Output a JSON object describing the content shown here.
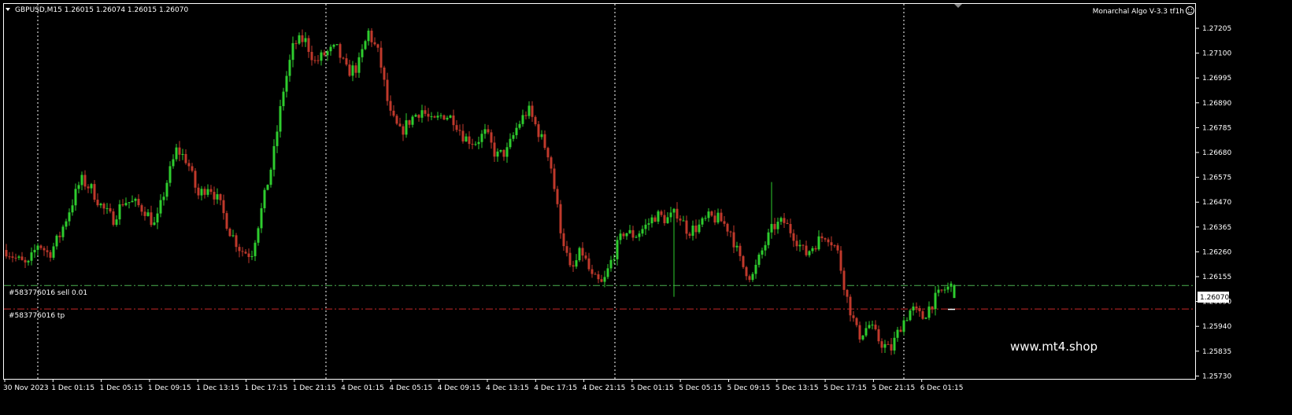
{
  "header": {
    "symbol_line": "GBPUSD,M15  1.26015 1.26074 1.26015 1.26070",
    "indicator": "Monarchal Algo V-3.3 tf1h",
    "smiley_icon": "smiley-icon"
  },
  "order_lines": {
    "sell": {
      "label": "#583776016 sell 0.01",
      "price": 1.2607,
      "color": "#4caf50"
    },
    "tp": {
      "label": "#583776016 tp",
      "price": 1.2597,
      "color": "#c62828"
    }
  },
  "current_price": "1.26070",
  "watermark": "www.mt4.shop",
  "colors": {
    "bull": "#2ecc2e",
    "bear": "#c0392b",
    "background": "#000000",
    "grid": "#ffffff"
  },
  "chart_data": {
    "type": "candlestick",
    "symbol": "GBPUSD",
    "timeframe": "M15",
    "ylim": [
      1.2567,
      1.2727
    ],
    "y_ticks": [
      "1.27205",
      "1.27100",
      "1.26995",
      "1.26890",
      "1.26785",
      "1.26680",
      "1.26575",
      "1.26470",
      "1.26365",
      "1.26260",
      "1.26155",
      "1.26050",
      "1.25940",
      "1.25835",
      "1.25730"
    ],
    "x_ticks": [
      "30 Nov 2023",
      "1 Dec 01:15",
      "1 Dec 05:15",
      "1 Dec 09:15",
      "1 Dec 13:15",
      "1 Dec 17:15",
      "1 Dec 21:15",
      "4 Dec 01:15",
      "4 Dec 05:15",
      "4 Dec 09:15",
      "4 Dec 13:15",
      "4 Dec 17:15",
      "4 Dec 21:15",
      "5 Dec 01:15",
      "5 Dec 05:15",
      "5 Dec 09:15",
      "5 Dec 13:15",
      "5 Dec 17:15",
      "5 Dec 21:15",
      "6 Dec 01:15"
    ],
    "day_separators": [
      "1 Dec 00:00",
      "4 Dec 00:00",
      "5 Dec 00:00",
      "6 Dec 00:00"
    ],
    "close_path": [
      1.2622,
      1.2618,
      1.2615,
      1.2625,
      1.262,
      1.2628,
      1.264,
      1.2652,
      1.2648,
      1.264,
      1.2635,
      1.2643,
      1.2642,
      1.2639,
      1.2632,
      1.265,
      1.2665,
      1.266,
      1.2645,
      1.265,
      1.2642,
      1.263,
      1.2622,
      1.262,
      1.264,
      1.266,
      1.269,
      1.271,
      1.2712,
      1.2702,
      1.2706,
      1.2708,
      1.2698,
      1.27,
      1.2715,
      1.2705,
      1.268,
      1.2672,
      1.2678,
      1.2682,
      1.2676,
      1.268,
      1.2678,
      1.267,
      1.2668,
      1.2672,
      1.2662,
      1.2664,
      1.2675,
      1.2682,
      1.2672,
      1.2662,
      1.2632,
      1.2612,
      1.2622,
      1.261,
      1.2607,
      1.262,
      1.263,
      1.2628,
      1.2632,
      1.2637,
      1.2635,
      1.2638,
      1.263,
      1.2632,
      1.2636,
      1.2635,
      1.263,
      1.2616,
      1.261,
      1.2622,
      1.2632,
      1.2634,
      1.2628,
      1.262,
      1.2625,
      1.2629,
      1.2622,
      1.26,
      1.2585,
      1.259,
      1.2583,
      1.2579,
      1.259,
      1.2597,
      1.2593,
      1.26,
      1.2605,
      1.2607
    ],
    "last_candle": {
      "open": 1.26015,
      "high": 1.26074,
      "low": 1.26015,
      "close": 1.2607
    }
  }
}
